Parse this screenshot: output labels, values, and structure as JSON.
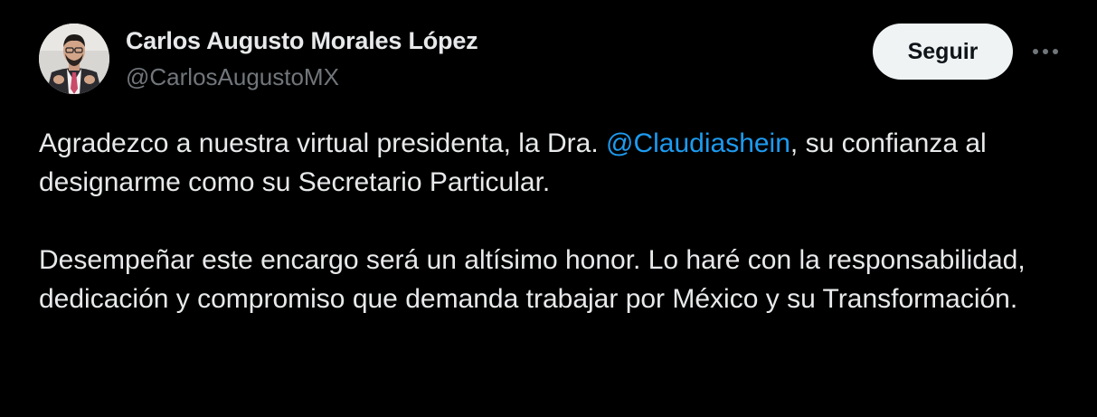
{
  "author": {
    "name": "Carlos Augusto Morales López",
    "handle": "@CarlosAugustoMX"
  },
  "actions": {
    "follow_label": "Seguir",
    "more_icon": "more-horizontal-icon"
  },
  "tweet": {
    "p1_before": "Agradezco a nuestra virtual presidenta, la Dra. ",
    "p1_mention": "@Claudiashein",
    "p1_after": ", su confianza al designarme como su Secretario Particular.",
    "p2": "Desempeñar este encargo será un altísimo honor. Lo haré con la responsabilidad, dedicación y compromiso que demanda trabajar por México y su Transformación."
  },
  "colors": {
    "background": "#000000",
    "text": "#e7e9ea",
    "secondary_text": "#71767b",
    "link": "#1d9bf0",
    "button_bg": "#eff3f4"
  }
}
